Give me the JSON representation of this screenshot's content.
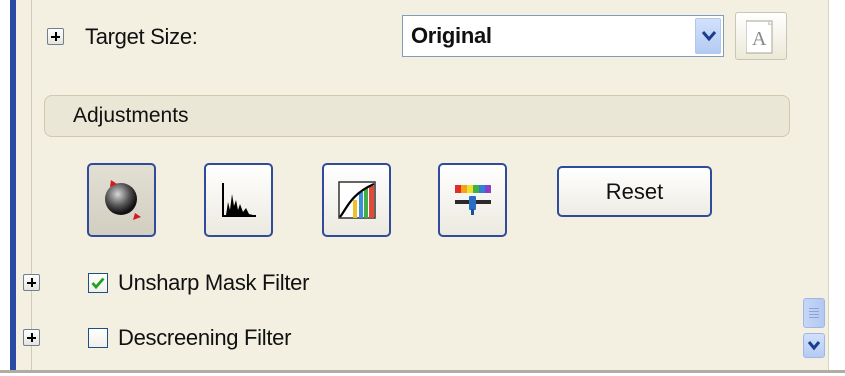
{
  "target_size": {
    "label": "Target Size:",
    "selected": "Original",
    "options_visible": [
      "Original"
    ]
  },
  "adjustments": {
    "header": "Adjustments",
    "buttons": [
      {
        "icon": "image-adjustment-sphere-icon"
      },
      {
        "icon": "histogram-icon"
      },
      {
        "icon": "tone-curve-icon"
      },
      {
        "icon": "color-palette-slider-icon"
      }
    ],
    "reset_label": "Reset"
  },
  "filters": {
    "unsharp": {
      "label": "Unsharp Mask Filter",
      "checked": true
    },
    "descreening": {
      "label": "Descreening Filter",
      "checked": false
    }
  },
  "colors": {
    "accent_blue": "#2f4b9a",
    "panel_bg": "#f3f0e2",
    "check_green": "#21a121"
  }
}
